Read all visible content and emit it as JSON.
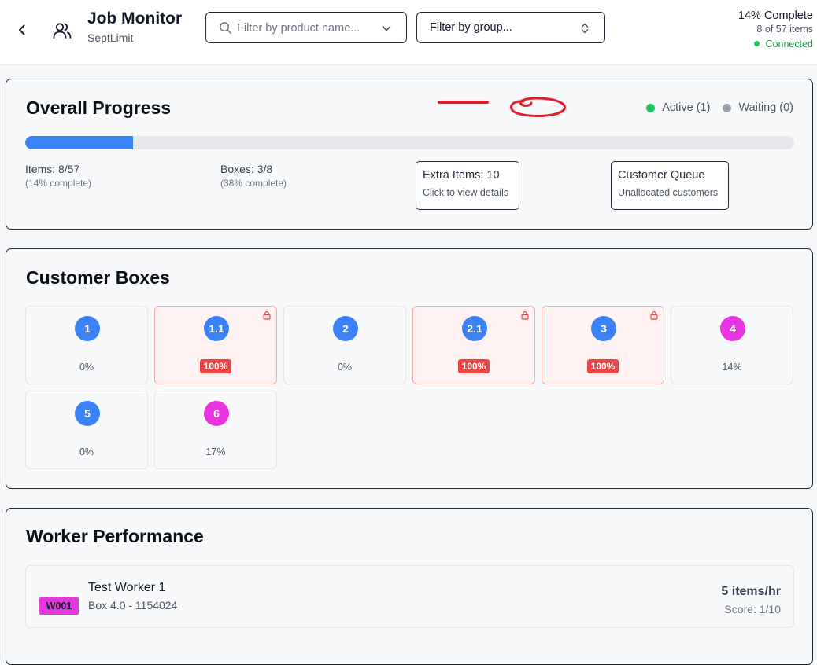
{
  "header": {
    "title": "Job Monitor",
    "subtitle": "SeptLimit",
    "search_placeholder": "Filter by product name...",
    "group_select_label": "Filter by group...",
    "complete_text": "14% Complete",
    "items_text": "8 of 57 items",
    "connection_status": "Connected",
    "connection_color": "#22c55e"
  },
  "overall": {
    "title": "Overall Progress",
    "legend_active": "Active (1)",
    "legend_waiting": "Waiting (0)",
    "active_color": "#22c55e",
    "waiting_color": "#9ca3af",
    "progress_fraction": 0.14,
    "items_label": "Items: 8/57",
    "items_sub": "(14% complete)",
    "boxes_label": "Boxes: 3/8",
    "boxes_sub": "(38% complete)",
    "extra_items_label": "Extra Items: 10",
    "extra_items_sub": "Click to view details",
    "customer_queue_label": "Customer Queue",
    "customer_queue_sub": "Unallocated customers"
  },
  "boxes_section": {
    "title": "Customer Boxes",
    "boxes": [
      {
        "label": "1",
        "percent": "0%",
        "color": "#3b82f6",
        "locked": false
      },
      {
        "label": "1.1",
        "percent": "100%",
        "color": "#3b82f6",
        "locked": true
      },
      {
        "label": "2",
        "percent": "0%",
        "color": "#3b82f6",
        "locked": false
      },
      {
        "label": "2.1",
        "percent": "100%",
        "color": "#3b82f6",
        "locked": true
      },
      {
        "label": "3",
        "percent": "100%",
        "color": "#3b82f6",
        "locked": true
      },
      {
        "label": "4",
        "percent": "14%",
        "color": "#e935e0",
        "locked": false
      },
      {
        "label": "5",
        "percent": "0%",
        "color": "#3b82f6",
        "locked": false
      },
      {
        "label": "6",
        "percent": "17%",
        "color": "#e935e0",
        "locked": false
      }
    ]
  },
  "workers": {
    "title": "Worker Performance",
    "list": [
      {
        "code": "W001",
        "name": "Test Worker 1",
        "box": "Box 4.0 - 1154024",
        "rate": "5 items/hr",
        "score": "Score: 1/10"
      }
    ]
  },
  "accent": "#3b82f6"
}
